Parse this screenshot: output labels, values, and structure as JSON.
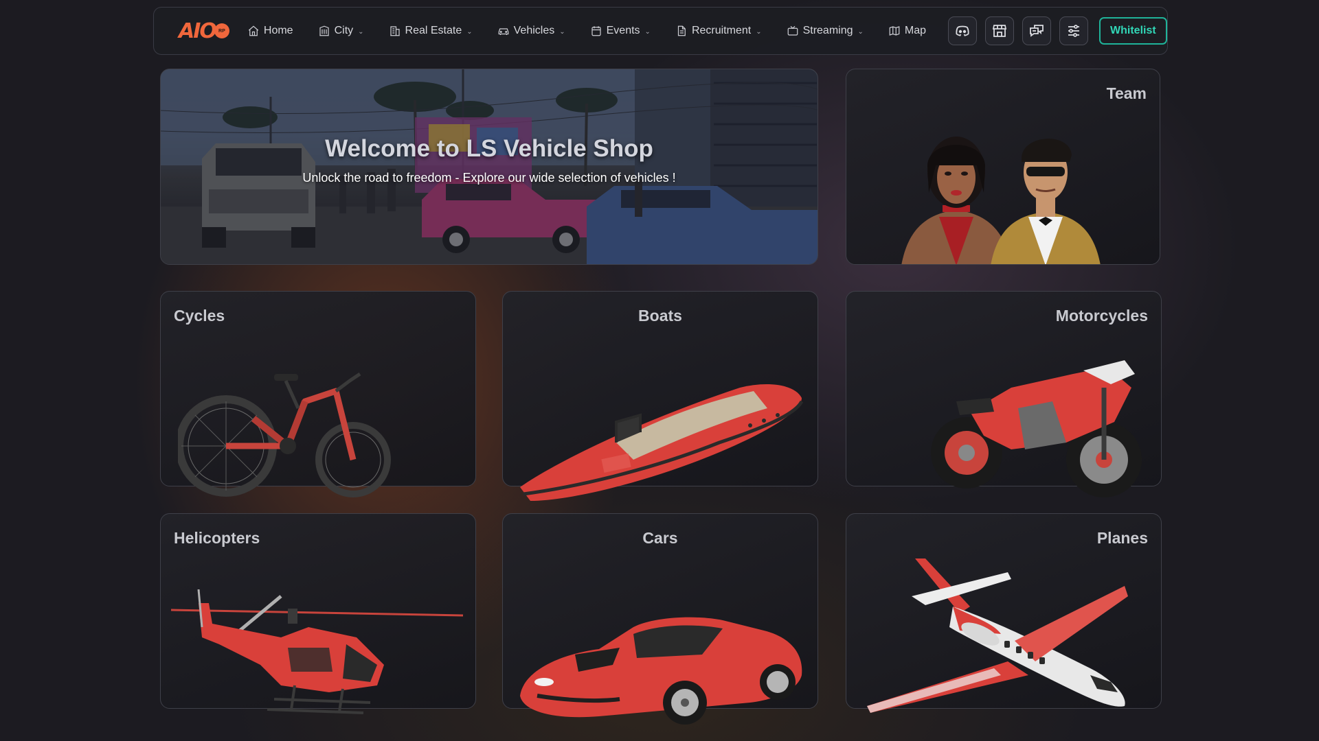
{
  "logo": {
    "text": "AIO",
    "badge": "RP"
  },
  "nav": {
    "items": [
      {
        "label": "Home",
        "icon": "home-icon",
        "dropdown": false
      },
      {
        "label": "City",
        "icon": "building-icon",
        "dropdown": true
      },
      {
        "label": "Real Estate",
        "icon": "real-estate-icon",
        "dropdown": true
      },
      {
        "label": "Vehicles",
        "icon": "car-icon",
        "dropdown": true
      },
      {
        "label": "Events",
        "icon": "calendar-icon",
        "dropdown": true
      },
      {
        "label": "Recruitment",
        "icon": "document-icon",
        "dropdown": true
      },
      {
        "label": "Streaming",
        "icon": "tv-icon",
        "dropdown": true
      },
      {
        "label": "Map",
        "icon": "map-icon",
        "dropdown": false
      }
    ],
    "tools": [
      "discord-icon",
      "store-icon",
      "chat-icon",
      "settings-sliders-icon"
    ],
    "whitelist_label": "Whitelist"
  },
  "hero": {
    "title": "Welcome to LS Vehicle Shop",
    "subtitle": "Unlock the road to freedom - Explore our wide selection of vehicles !"
  },
  "team": {
    "title": "Team"
  },
  "categories": {
    "cycles": "Cycles",
    "boats": "Boats",
    "motorcycles": "Motorcycles",
    "helicopters": "Helicopters",
    "cars": "Cars",
    "planes": "Planes"
  },
  "colors": {
    "accent": "#f0673c",
    "whitelist": "#1fb49a",
    "vehicle_red": "#d9403a"
  }
}
